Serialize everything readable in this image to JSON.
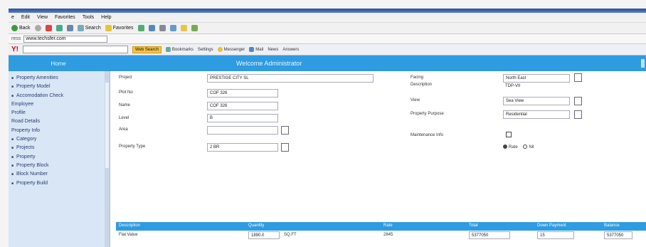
{
  "menu": [
    "e",
    "Edit",
    "View",
    "Favorites",
    "Tools",
    "Help"
  ],
  "toolbar": {
    "back_label": "Back",
    "search_label": "Search",
    "favorites_label": "Favorites"
  },
  "address": {
    "label": "ress",
    "value": "www.techsfer.com"
  },
  "search_toolbar": {
    "button_label": "Web Search",
    "items": [
      "Bookmarks",
      "Settings",
      "Messenger",
      "Mail",
      "News",
      "Answers"
    ]
  },
  "header": {
    "home": "Home",
    "welcome": "Welcome Administrator"
  },
  "sidebar": {
    "items": [
      {
        "label": "Property Amenities",
        "type": "sub"
      },
      {
        "label": "Property Model",
        "type": "sub"
      },
      {
        "label": "Accomodation Check",
        "type": "sub"
      },
      {
        "label": "Employee",
        "type": "grp"
      },
      {
        "label": "Profile",
        "type": "grp"
      },
      {
        "label": "Road Details",
        "type": "grp"
      },
      {
        "label": "Property Info",
        "type": "grp"
      },
      {
        "label": "Category",
        "type": "sub"
      },
      {
        "label": "Projects",
        "type": "sub"
      },
      {
        "label": "Property",
        "type": "sub"
      },
      {
        "label": "Property Block",
        "type": "sub"
      },
      {
        "label": "Block Number",
        "type": "sub"
      },
      {
        "label": "Property Build",
        "type": "sub"
      }
    ]
  },
  "form": {
    "project_label": "Project",
    "project_value": "PRESTIGE CITY SL",
    "plot_no_label": "Plot No",
    "plot_no_value": "COF 326",
    "name_label": "Name",
    "name_value": "COF 326",
    "level_label": "Level",
    "level_value": "B",
    "area_label": "Area",
    "area_value": "",
    "property_type_label": "Property Type",
    "property_type_value": "2 BR",
    "facing_label": "Facing",
    "facing_value": "North East",
    "description_label": "Description",
    "description_value": "TDP-VII",
    "view_label": "View",
    "view_value": "Sea View",
    "purpose_label": "Property Purpose",
    "purpose_value": "Residential",
    "maintenance_label": "Maintenance Info",
    "rate_options": [
      "Rate",
      "Nil"
    ]
  },
  "grid": {
    "headers": [
      "Description",
      "Quantity",
      "Rate",
      "Total",
      "Down Payment",
      "Balance"
    ],
    "row": [
      "Flat Value",
      "1890.0",
      "SQ.FT",
      "2845",
      "5377050",
      "15",
      "5377050"
    ]
  }
}
